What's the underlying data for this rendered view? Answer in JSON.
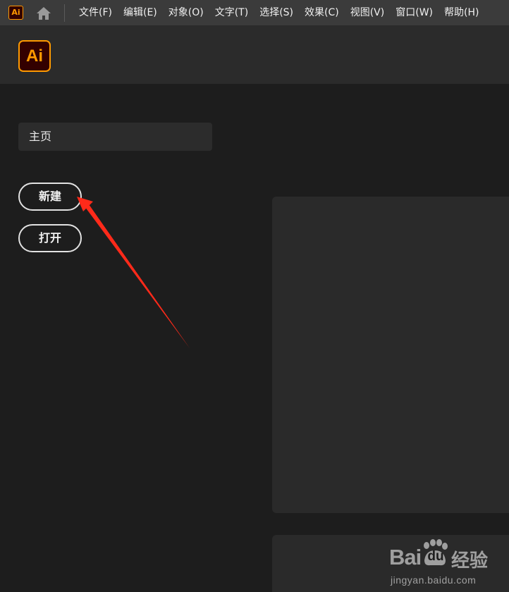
{
  "menubar": {
    "app_icon_label": "Ai",
    "home_icon": "home-icon",
    "items": [
      {
        "label": "文件(F)"
      },
      {
        "label": "编辑(E)"
      },
      {
        "label": "对象(O)"
      },
      {
        "label": "文字(T)"
      },
      {
        "label": "选择(S)"
      },
      {
        "label": "效果(C)"
      },
      {
        "label": "视图(V)"
      },
      {
        "label": "窗口(W)"
      },
      {
        "label": "帮助(H)"
      }
    ]
  },
  "header": {
    "logo_label": "Ai",
    "logo_color": "#ff9a00",
    "logo_bg": "#330000"
  },
  "sidebar": {
    "home_label": "主页",
    "new_button_label": "新建",
    "open_button_label": "打开"
  },
  "annotation": {
    "arrow_color": "#ff2a1a"
  },
  "watermark": {
    "brand": "Bai",
    "brand_mid": "du",
    "product": "经验",
    "url": "jingyan.baidu.com"
  }
}
